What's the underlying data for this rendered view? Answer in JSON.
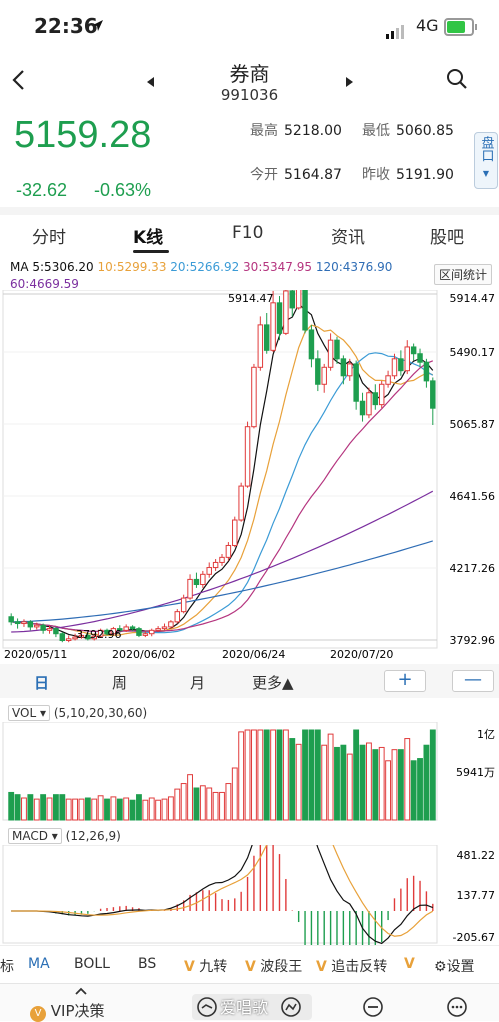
{
  "status_bar": {
    "time": "22:36",
    "network": "4G"
  },
  "header": {
    "title": "券商",
    "code": "991036"
  },
  "quote": {
    "price": "5159.28",
    "change": "-32.62",
    "change_pct": "-0.63%",
    "high_label": "最高",
    "high_value": "5218.00",
    "low_label": "最低",
    "low_value": "5060.85",
    "open_label": "今开",
    "open_value": "5164.87",
    "prev_label": "昨收",
    "prev_value": "5191.90",
    "pankou_label": "盘口"
  },
  "tabs": [
    "分时",
    "K线",
    "F10",
    "资讯",
    "股吧"
  ],
  "active_tab": "K线",
  "ma_legend": {
    "ma5": "MA 5:5306.20",
    "ma10": "10:5299.33",
    "ma20": "20:5266.92",
    "ma30": "30:5347.95",
    "ma120": "120:4376.90",
    "ma60": "60:4669.59"
  },
  "range_stat_label": "区间统计",
  "colors": {
    "up": "#e03b3b",
    "down": "#1e9e4f",
    "ma5": "#111111",
    "ma10": "#e8a13a",
    "ma20": "#3b9bd6",
    "ma30": "#b5357f",
    "ma60": "#7b2f9f",
    "ma120": "#2f6db5"
  },
  "chart_data": {
    "type": "candlestick",
    "price_axis": [
      "5914.47",
      "5490.17",
      "5065.87",
      "4641.56",
      "4217.26",
      "3792.96"
    ],
    "date_axis": [
      "2020/05/11",
      "2020/06/02",
      "2020/06/24",
      "2020/07/20"
    ],
    "max_label": "5914.47",
    "min_label": "3792.96",
    "candles": [
      [
        3930,
        3900,
        3950,
        3880
      ],
      [
        3900,
        3890,
        3920,
        3860
      ],
      [
        3890,
        3900,
        3915,
        3870
      ],
      [
        3900,
        3870,
        3910,
        3850
      ],
      [
        3870,
        3880,
        3895,
        3855
      ],
      [
        3880,
        3850,
        3890,
        3830
      ],
      [
        3850,
        3860,
        3875,
        3830
      ],
      [
        3860,
        3830,
        3870,
        3810
      ],
      [
        3830,
        3790,
        3840,
        3780
      ],
      [
        3790,
        3800,
        3820,
        3780
      ],
      [
        3800,
        3810,
        3830,
        3790
      ],
      [
        3810,
        3820,
        3840,
        3800
      ],
      [
        3820,
        3800,
        3835,
        3790
      ],
      [
        3800,
        3815,
        3830,
        3790
      ],
      [
        3815,
        3850,
        3860,
        3805
      ],
      [
        3850,
        3830,
        3860,
        3820
      ],
      [
        3830,
        3860,
        3870,
        3820
      ],
      [
        3860,
        3850,
        3880,
        3840
      ],
      [
        3850,
        3870,
        3885,
        3840
      ],
      [
        3870,
        3860,
        3880,
        3845
      ],
      [
        3860,
        3820,
        3870,
        3810
      ],
      [
        3820,
        3830,
        3845,
        3810
      ],
      [
        3830,
        3850,
        3860,
        3815
      ],
      [
        3850,
        3860,
        3875,
        3840
      ],
      [
        3860,
        3870,
        3890,
        3850
      ],
      [
        3870,
        3900,
        3910,
        3860
      ],
      [
        3900,
        3960,
        3975,
        3890
      ],
      [
        3960,
        4040,
        4060,
        3950
      ],
      [
        4040,
        4150,
        4180,
        4030
      ],
      [
        4150,
        4120,
        4190,
        4100
      ],
      [
        4120,
        4180,
        4200,
        4100
      ],
      [
        4180,
        4220,
        4250,
        4160
      ],
      [
        4220,
        4250,
        4270,
        4200
      ],
      [
        4250,
        4280,
        4300,
        4230
      ],
      [
        4280,
        4350,
        4370,
        4260
      ],
      [
        4350,
        4500,
        4520,
        4340
      ],
      [
        4500,
        4700,
        4720,
        4490
      ],
      [
        4700,
        5050,
        5080,
        4690
      ],
      [
        5050,
        5400,
        5420,
        5040
      ],
      [
        5400,
        5650,
        5700,
        5380
      ],
      [
        5650,
        5500,
        5720,
        5480
      ],
      [
        5500,
        5780,
        5850,
        5490
      ],
      [
        5780,
        5600,
        5820,
        5560
      ],
      [
        5600,
        5850,
        5914,
        5590
      ],
      [
        5850,
        5750,
        5900,
        5700
      ],
      [
        5750,
        5880,
        5914,
        5740
      ],
      [
        5880,
        5620,
        5900,
        5600
      ],
      [
        5620,
        5450,
        5650,
        5400
      ],
      [
        5450,
        5300,
        5500,
        5260
      ],
      [
        5300,
        5400,
        5420,
        5250
      ],
      [
        5400,
        5560,
        5600,
        5380
      ],
      [
        5560,
        5450,
        5580,
        5420
      ],
      [
        5450,
        5350,
        5470,
        5300
      ],
      [
        5350,
        5420,
        5450,
        5320
      ],
      [
        5420,
        5200,
        5440,
        5150
      ],
      [
        5200,
        5120,
        5250,
        5080
      ],
      [
        5120,
        5250,
        5280,
        5100
      ],
      [
        5250,
        5180,
        5300,
        5150
      ],
      [
        5180,
        5300,
        5320,
        5160
      ],
      [
        5300,
        5350,
        5380,
        5280
      ],
      [
        5350,
        5450,
        5480,
        5330
      ],
      [
        5450,
        5380,
        5500,
        5350
      ],
      [
        5380,
        5520,
        5560,
        5360
      ],
      [
        5520,
        5480,
        5540,
        5440
      ],
      [
        5480,
        5430,
        5510,
        5400
      ],
      [
        5430,
        5320,
        5450,
        5280
      ],
      [
        5320,
        5159,
        5340,
        5060
      ]
    ],
    "volume_axis": [
      "1亿",
      "5941万"
    ],
    "volume_label": "VOL",
    "volume_params": "(5,10,20,30,60)",
    "macd_label": "MACD",
    "macd_params": "(12,26,9)",
    "macd_axis": [
      "481.22",
      "137.77",
      "-205.67"
    ]
  },
  "period_tabs": [
    "日",
    "周",
    "月",
    "更多▲"
  ],
  "zoom": {
    "plus": "+",
    "minus": "—"
  },
  "indicators": [
    "标",
    "MA",
    "BOLL",
    "BS",
    "九转",
    "波段王",
    "追击反转",
    "设置"
  ],
  "indicator_vip_mark": "V",
  "bottom": {
    "vip_label": "VIP决策",
    "watermark": "爱唱歌"
  }
}
